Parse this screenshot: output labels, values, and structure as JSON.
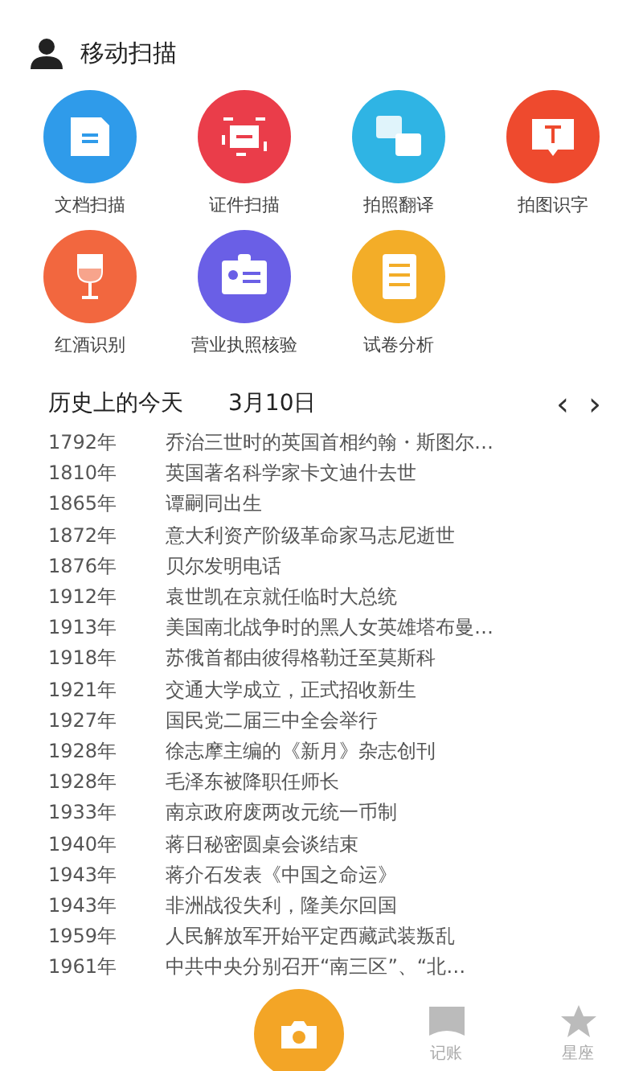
{
  "header": {
    "title": "移动扫描"
  },
  "tools": [
    {
      "label": "文档扫描",
      "kind": "doc",
      "color": "#2f9bea"
    },
    {
      "label": "证件扫描",
      "kind": "card",
      "color": "#ea3d4a"
    },
    {
      "label": "拍照翻译",
      "kind": "translate",
      "color": "#2fb4e4"
    },
    {
      "label": "拍图识字",
      "kind": "text",
      "color": "#ee4a2e"
    },
    {
      "label": "红酒识别",
      "kind": "wine",
      "color": "#f2673f"
    },
    {
      "label": "营业执照核验",
      "kind": "license",
      "color": "#6a5fe6"
    },
    {
      "label": "试卷分析",
      "kind": "paper",
      "color": "#f3ad28"
    }
  ],
  "history": {
    "title": "历史上的今天",
    "date": "3月10日",
    "prev": "‹",
    "next": "›",
    "events": [
      {
        "year": "1792年",
        "text": "乔治三世时的英国首相约翰・斯图尔…"
      },
      {
        "year": "1810年",
        "text": "英国著名科学家卡文迪什去世"
      },
      {
        "year": "1865年",
        "text": "谭嗣同出生"
      },
      {
        "year": "1872年",
        "text": "意大利资产阶级革命家马志尼逝世"
      },
      {
        "year": "1876年",
        "text": "贝尔发明电话"
      },
      {
        "year": "1912年",
        "text": "袁世凯在京就任临时大总统"
      },
      {
        "year": "1913年",
        "text": "美国南北战争时的黑人女英雄塔布曼…"
      },
      {
        "year": "1918年",
        "text": "苏俄首都由彼得格勒迁至莫斯科"
      },
      {
        "year": "1921年",
        "text": "交通大学成立，正式招收新生"
      },
      {
        "year": "1927年",
        "text": "国民党二届三中全会举行"
      },
      {
        "year": "1928年",
        "text": "徐志摩主编的《新月》杂志创刊"
      },
      {
        "year": "1928年",
        "text": "毛泽东被降职任师长"
      },
      {
        "year": "1933年",
        "text": "南京政府废两改元统一币制"
      },
      {
        "year": "1940年",
        "text": "蒋日秘密圆桌会谈结束"
      },
      {
        "year": "1943年",
        "text": "蒋介石发表《中国之命运》"
      },
      {
        "year": "1943年",
        "text": "非洲战役失利，隆美尔回国"
      },
      {
        "year": "1959年",
        "text": "人民解放军开始平定西藏武装叛乱"
      },
      {
        "year": "1961年",
        "text": "中共中央分别召开“南三区”、“北…"
      }
    ]
  },
  "nav": [
    {
      "label": "记账",
      "kind": "book"
    },
    {
      "label": "星座",
      "kind": "star"
    }
  ]
}
